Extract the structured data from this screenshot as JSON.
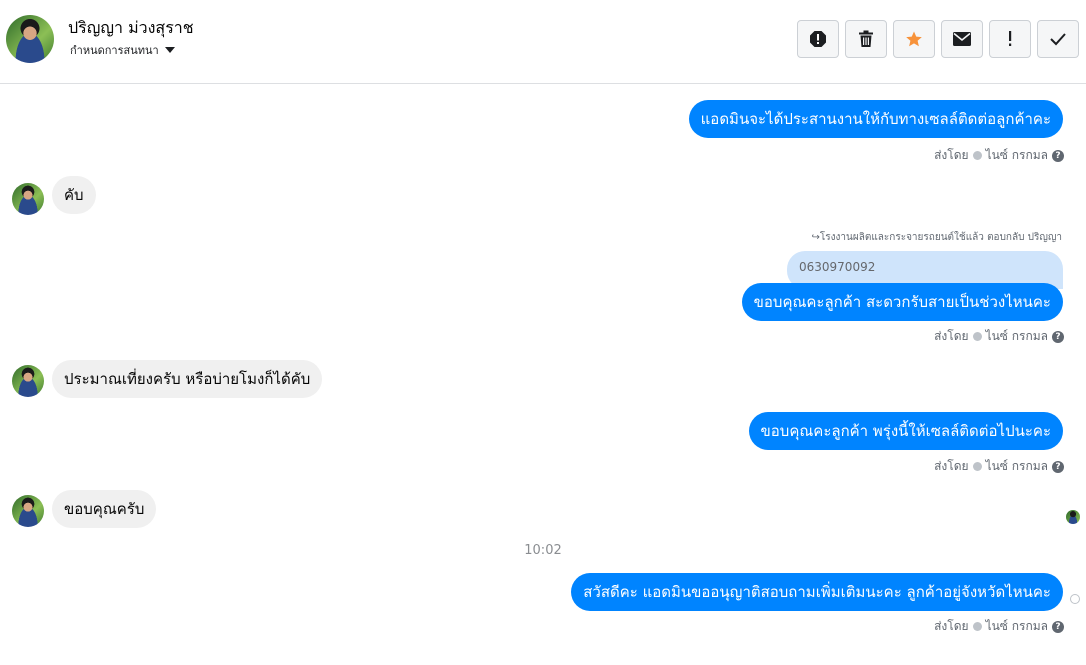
{
  "header": {
    "contact_name": "ปริญญา ม่วงสุราช",
    "assign_label": "กำหนดการสนทนา",
    "toolbar": {
      "spam_icon": "alert-octagon-icon",
      "delete_icon": "trash-icon",
      "star_icon": "star-icon",
      "unread_icon": "envelope-icon",
      "follow_up_icon": "exclamation-icon",
      "done_icon": "checkmark-icon"
    }
  },
  "colors": {
    "outgoing_bubble": "#0084ff",
    "incoming_bubble": "#f0f0f0",
    "quoted_bubble": "#cfe4fb",
    "star": "#f7923a"
  },
  "messages": [
    {
      "direction": "out",
      "text": "แอดมินจะได้ประสานงานให้กับทางเซลล์ติดต่อลูกค้าคะ"
    },
    {
      "direction": "in",
      "text": "คับ"
    },
    {
      "direction": "out",
      "text": "ขอบคุณคะลูกค้า สะดวกรับสายเป็นช่วงไหนคะ",
      "reply_meta": "↪โรงงานผลิตและกระจายรถยนต์ใช้แล้ว ตอบกลับ ปริญญา",
      "quoted_text": "0630970092"
    },
    {
      "direction": "in",
      "text": "ประมาณเที่ยงครับ หรือบ่ายโมงก็ได้คับ"
    },
    {
      "direction": "out",
      "text": "ขอบคุณคะลูกค้า พรุ่งนี้ให้เซลล์ติดต่อไปนะคะ"
    },
    {
      "direction": "in",
      "text": "ขอบคุณครับ"
    },
    {
      "direction": "out",
      "text": "สวัสดีคะ แอดมินขออนุญาติสอบถามเพิ่มเติมนะคะ ลูกค้าอยู่จังหวัดไหนคะ"
    }
  ],
  "sent_by": {
    "prefix": "ส่งโดย",
    "name": "ไนซ์ กรกมล",
    "help": "?"
  },
  "time_separator": "10:02"
}
